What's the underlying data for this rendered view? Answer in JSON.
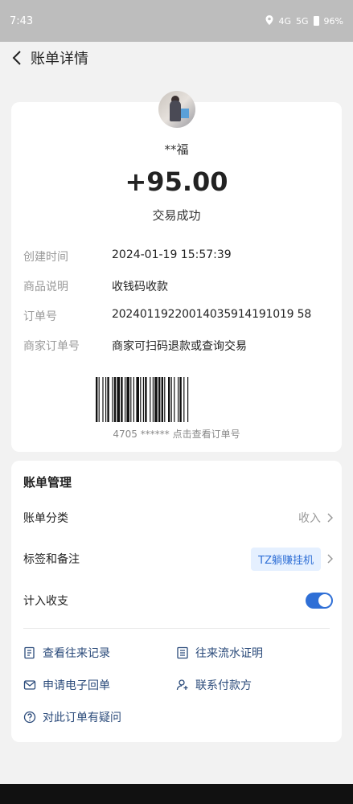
{
  "status_bar": {
    "time": "7:43",
    "battery": "96%",
    "net1": "4G",
    "net2": "5G"
  },
  "nav": {
    "title": "账单详情"
  },
  "bill": {
    "payer_name": "**福",
    "amount": "+95.00",
    "status": "交易成功",
    "rows": [
      {
        "key": "创建时间",
        "value": "2024-01-19 15:57:39"
      },
      {
        "key": "商品说明",
        "value": "收钱码收款"
      },
      {
        "key": "订单号",
        "value": "20240119220014035914191019 58"
      },
      {
        "key": "商家订单号",
        "value": "商家可扫码退款或查询交易"
      }
    ],
    "barcode_text": "4705 ****** 点击查看订单号"
  },
  "management": {
    "title": "账单管理",
    "category_label": "账单分类",
    "category_value": "收入",
    "tags_label": "标签和备注",
    "tag_value": "TZ躺赚挂机",
    "count_label": "计入收支",
    "count_enabled": true
  },
  "links": {
    "history": "查看往来记录",
    "statement": "往来流水证明",
    "receipt": "申请电子回单",
    "contact": "联系付款方",
    "question": "对此订单有疑问"
  }
}
